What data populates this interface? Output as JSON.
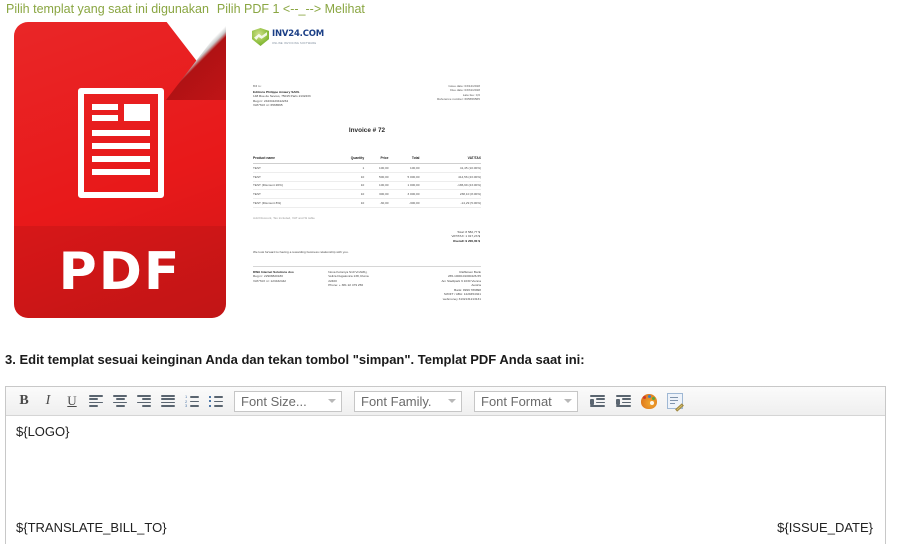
{
  "top_links": {
    "choose_current_template": "Pilih templat yang saat ini digunakan",
    "choose_pdf": "Pilih PDF 1",
    "arrows": "<--_-->",
    "view": "Melihat"
  },
  "pdf_thumbnail": {
    "label": "PDF",
    "color": "#e8191a",
    "icon": "pdf-file-icon"
  },
  "invoice_preview": {
    "logo_text": "INV24.COM",
    "logo_tagline": "ONLINE INVOICING SOFTWARE",
    "bill_to_label": "Bill to:",
    "bill_to_company": "Editions Philippe Amaury SARL",
    "bill_to_address": "148 Rue de Sevres, 75015 Paris 2132233",
    "bill_to_reg": "Reg nr: 24234123412234",
    "bill_to_vat": "VAT/TAX nr: 6566565",
    "issue_date": "Issue date: 03/12/2018",
    "due_date": "Due date: 03/31/2018",
    "late_fee": "Late fee: 0,6",
    "reference_number": "Reference number: 665656565",
    "title": "Invoice # 72",
    "columns": [
      "Product name",
      "Quantity",
      "Price",
      "Total",
      "VAT/TAX"
    ],
    "rows": [
      [
        "TEST",
        "1",
        "100,00",
        "100,00",
        "41,45 (10.00%)"
      ],
      [
        "TEST",
        "10",
        "500,00",
        "5 000,00",
        "414,56 (23.00%)"
      ],
      [
        "TEST (Discount 20%)",
        "10",
        "100,00",
        "1 000,00",
        "-186,99 (23.00%)"
      ],
      [
        "TEST",
        "10",
        "300,00",
        "3 000,00",
        "238,10 (8.00%)"
      ],
      [
        "TEST (Discount 8%)",
        "10",
        "-30,00",
        "-300,00",
        "-14,29 (5.00%)"
      ]
    ],
    "note": "Add Discount, Tax included, VAT and SI table",
    "total": "Total: 8 582,77 $",
    "vat_total": "VAT/TAX: 1 017,23 $",
    "overall": "Overall: 9 200,00 $",
    "message": "We look forward to having a rewarding business relationship with you.",
    "footer_company": "DWA Internet Solutions doo",
    "footer_reg": "Reg nr: 22908820180",
    "footer_vat": "VAT/TAX nr: 123432442",
    "footer_addr1": "Nova Koloniya S10 Vrshi#1j,",
    "footer_addr2": "Veliza Dugalovica 138, Ruma",
    "footer_addr3": "22400",
    "footer_phone": "Phone: + 381 22 479 256",
    "bank_name": "Raiffeisen Bank",
    "bank_iban": "265-1000101000426-55",
    "bank_addr1": "Am Stadtpark 9 1030 Vienna",
    "bank_addr2": "Austria",
    "bank_bic": "Bank: 9999 789898",
    "bank_swift": "SWIFT / ABA: 1229454321",
    "bank_web": "webmoney 3132131213131"
  },
  "step3": {
    "heading": "3. Edit templat sesuai keinginan Anda dan tekan tombol \"simpan\". Templat PDF Anda saat ini:"
  },
  "editor": {
    "toolbar": {
      "bold": "B",
      "italic": "I",
      "underline": "U",
      "align_left": "align-left",
      "align_center": "align-center",
      "align_right": "align-right",
      "align_justify": "align-justify",
      "list_ordered": "ordered-list",
      "list_unordered": "unordered-list",
      "font_size": "Font Size...",
      "font_family": "Font Family.",
      "font_format": "Font Format",
      "outdent": "outdent",
      "indent": "indent",
      "color_palette": "color-palette",
      "source_edit": "source-edit"
    },
    "content": {
      "line1": "${LOGO}",
      "bill_to_var": "${TRANSLATE_BILL_TO}",
      "issue_date_var": "${ISSUE_DATE}"
    }
  }
}
